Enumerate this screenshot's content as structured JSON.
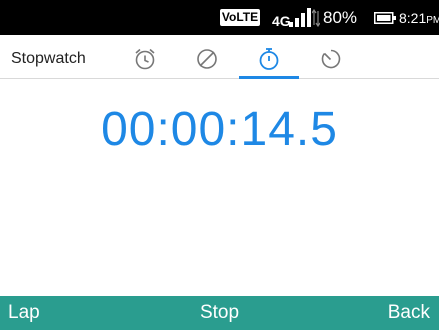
{
  "status_bar": {
    "volte": "VoLTE",
    "network": "4G",
    "battery_percent": "80%",
    "time": "8:21",
    "ampm": "PM",
    "signal_icon": "signal-bars-icon",
    "battery_icon": "battery-icon"
  },
  "header": {
    "title": "Stopwatch",
    "tabs": [
      {
        "icon": "alarm-clock-icon",
        "active": false
      },
      {
        "icon": "world-clock-icon",
        "active": false
      },
      {
        "icon": "stopwatch-icon",
        "active": true
      },
      {
        "icon": "timer-icon",
        "active": false
      }
    ]
  },
  "main": {
    "elapsed": "00:00:14.5"
  },
  "softkeys": {
    "left": "Lap",
    "center": "Stop",
    "right": "Back"
  },
  "colors": {
    "accent": "#1e88e5",
    "softkey_bar": "#2a9d8f",
    "status_bar": "#000000"
  }
}
